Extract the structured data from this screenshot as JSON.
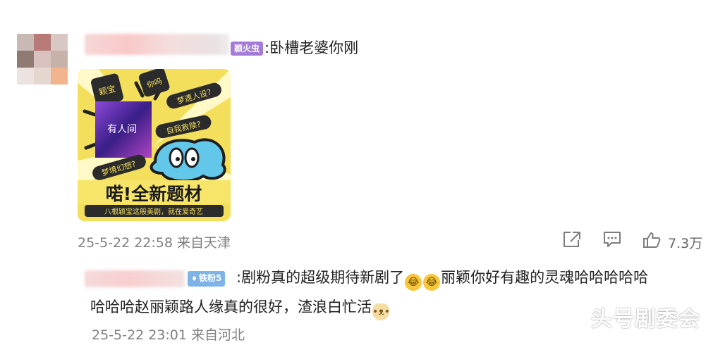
{
  "comment1": {
    "badge": "颖火虫",
    "text": ":卧槽老婆你刚",
    "sticker": {
      "left_bubbles": [
        "颖宝",
        "你吗"
      ],
      "chip_text_1": "梦遗人设?",
      "chip_text_2": "自我救赎?",
      "chip_text_3": "梦境幻想?",
      "poster_text": "有人间",
      "headline": "喏!全新题材",
      "footer": "八根颖宝这般美剧，就在爱奇艺"
    },
    "meta": "25-5-22 22:58 来自天津",
    "like_count": "7.3万"
  },
  "reply": {
    "badge": "铁粉5",
    "line1_a": ":剧粉真的超级期待新剧了",
    "line1_b": "丽颖你好有趣的灵魂哈哈哈哈哈",
    "line2": "哈哈哈赵丽颖路人缘真的很好，渣浪白忙活",
    "meta": "25-5-22 23:01 来自河北"
  },
  "watermark": "头号剧委会"
}
